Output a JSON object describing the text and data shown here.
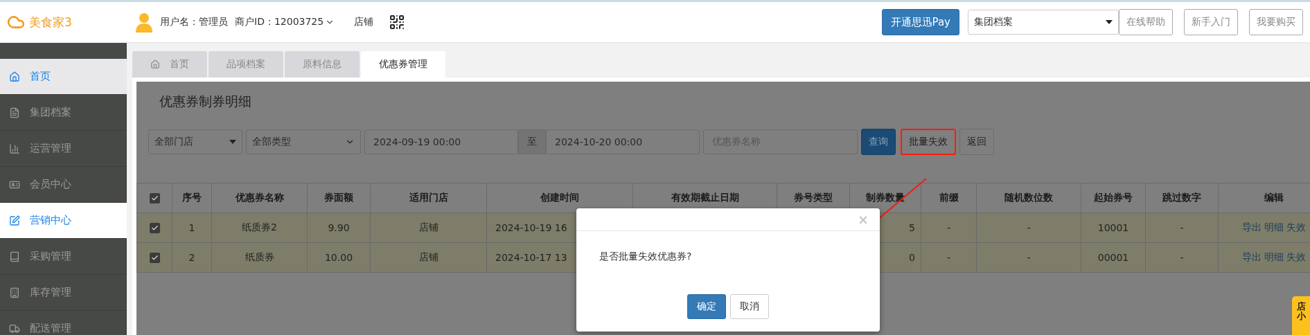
{
  "brand": {
    "name": "美食家3"
  },
  "user": {
    "name": "用户名：管理员",
    "merchant": "商户ID：12003725",
    "store": "店铺"
  },
  "header": {
    "pay_button": "开通思迅Pay",
    "group_select": "集团档案",
    "buttons": [
      "在线帮助",
      "新手入门",
      "我要购买"
    ]
  },
  "sidebar": {
    "items": [
      {
        "label": "首页",
        "selected": false,
        "hovered": true
      },
      {
        "label": "集团档案",
        "selected": false,
        "hovered": false
      },
      {
        "label": "运营管理",
        "selected": false,
        "hovered": false
      },
      {
        "label": "会员中心",
        "selected": false,
        "hovered": false
      },
      {
        "label": "营销中心",
        "selected": true,
        "hovered": false
      },
      {
        "label": "采购管理",
        "selected": false,
        "hovered": false
      },
      {
        "label": "库存管理",
        "selected": false,
        "hovered": false
      },
      {
        "label": "配送管理",
        "selected": false,
        "hovered": false
      }
    ]
  },
  "tabs": [
    {
      "label": "首页",
      "selected": false
    },
    {
      "label": "品项档案",
      "selected": false
    },
    {
      "label": "原料信息",
      "selected": false
    },
    {
      "label": "优惠券管理",
      "selected": true
    }
  ],
  "page": {
    "title": "优惠券制券明细",
    "filters": {
      "store_select": "全部门店",
      "type_select": "全部类型",
      "start": "2024-09-19 00:00",
      "to": "至",
      "end": "2024-10-20 00:00",
      "name_placeholder": "优惠券名称"
    },
    "buttons": [
      {
        "label": "查询",
        "kind": "primary",
        "highlighted": false
      },
      {
        "label": "批量失效",
        "kind": "default",
        "highlighted": true
      },
      {
        "label": "返回",
        "kind": "default",
        "highlighted": false
      }
    ]
  },
  "table": {
    "all_checked": true,
    "columns": [
      "序号",
      "优惠券名称",
      "券面额",
      "适用门店",
      "创建时间",
      "有效期截止日期",
      "券号类型",
      "制券数量",
      "前缀",
      "随机数位数",
      "起始券号",
      "跳过数字",
      "编辑"
    ],
    "rows": [
      {
        "checked": true,
        "cells": [
          "1",
          "纸质券2",
          "9.90",
          "店铺",
          "2024-10-19 16",
          "",
          "",
          "5",
          "-",
          "-",
          "10001",
          "-"
        ],
        "actions": [
          "导出",
          "明细",
          "失效"
        ]
      },
      {
        "checked": true,
        "cells": [
          "2",
          "纸质券",
          "10.00",
          "店铺",
          "2024-10-17 13",
          "",
          "",
          "0",
          "-",
          "-",
          "00001",
          "-"
        ],
        "actions": [
          "导出",
          "明细",
          "失效"
        ]
      }
    ]
  },
  "dialog": {
    "close": "×",
    "message": "是否批量失效优惠券?",
    "buttons": [
      {
        "label": "确定",
        "kind": "primary"
      },
      {
        "label": "取消",
        "kind": "default"
      }
    ]
  },
  "side_tab": {
    "label": "店小"
  }
}
